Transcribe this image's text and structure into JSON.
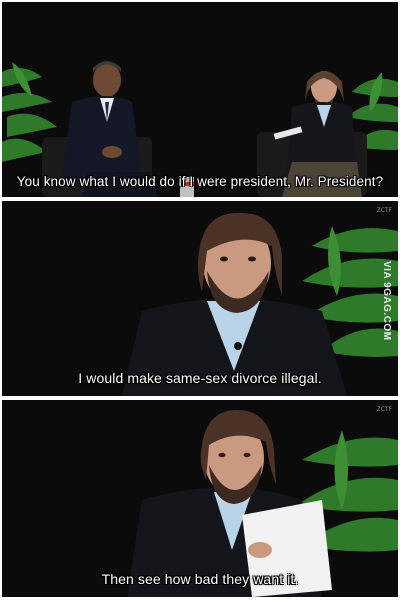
{
  "panels": [
    {
      "caption": "You know what I would do if I were president, Mr. President?"
    },
    {
      "caption": "I would make same-sex divorce illegal.",
      "watermark": "VIA 9GAG.COM",
      "corner_mark": "ZCTF"
    },
    {
      "caption": "Then see how bad they want it.",
      "corner_mark": "ZCTF"
    }
  ]
}
